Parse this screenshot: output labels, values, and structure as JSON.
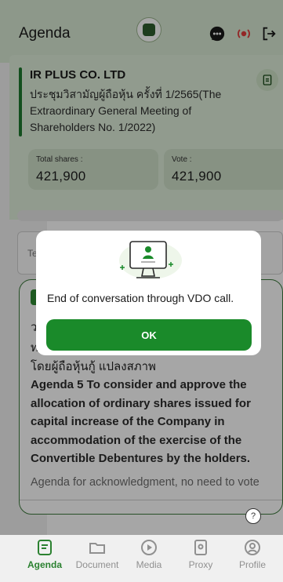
{
  "header": {
    "title": "Agenda",
    "icons": [
      "chat-icon",
      "live-broadcast-icon",
      "logout-icon"
    ]
  },
  "company": {
    "name": "IR PLUS CO. LTD",
    "meeting": "ประชุมวิสามัญผู้ถือหุ้น ครั้งที่ 1/2565(The Extraordinary General Meeting of Shareholders No. 1/2022)"
  },
  "stats": {
    "total_label": "Total shares :",
    "total_value": "421,900",
    "vote_label": "Vote :",
    "vote_value": "421,900"
  },
  "underlying": {
    "strip_text": "Te",
    "line1": "ว",
    "line2": "ท",
    "thai_line": "โดยผู้ถือหุ้นกู้ แปลงสภาพ",
    "agenda_topic": "Agenda 5 To consider and approve the allocation of ordinary shares issued for capital increase of the Company in accommodation of the exercise of the Convertible Debentures by the holders.",
    "agenda_note": "Agenda for acknowledgment, no need to vote"
  },
  "modal": {
    "message": "End of conversation through VDO call.",
    "ok_label": "OK"
  },
  "nav": {
    "items": [
      {
        "label": "Agenda",
        "icon": "agenda-icon",
        "active": true
      },
      {
        "label": "Document",
        "icon": "document-icon",
        "active": false
      },
      {
        "label": "Media",
        "icon": "media-play-icon",
        "active": false
      },
      {
        "label": "Proxy",
        "icon": "proxy-icon",
        "active": false
      },
      {
        "label": "Profile",
        "icon": "profile-icon",
        "active": false
      }
    ]
  },
  "colors": {
    "brand_green": "#1a8a2a",
    "header_bg": "#d9ead4",
    "active_nav": "#2e8a34"
  }
}
